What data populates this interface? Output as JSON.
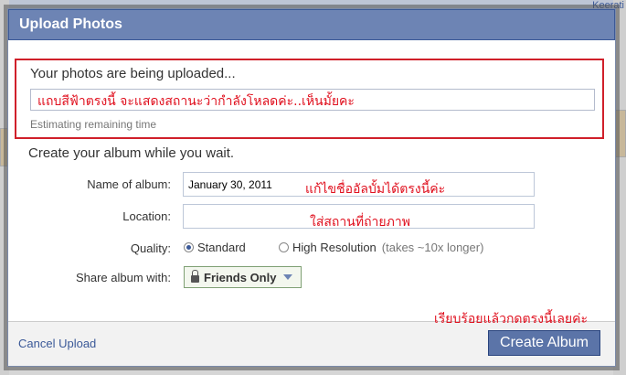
{
  "background": {
    "user_name": "Keerati"
  },
  "dialog": {
    "title": "Upload Photos",
    "upload_status": "Your photos are being uploaded...",
    "progress_fraction": 0.0,
    "progress_note": "แถบสีฟ้าตรงนี้ จะแสดงสถานะว่ากำลังโหลดค่ะ..เห็นมั้ยคะ",
    "estimating": "Estimating remaining time",
    "create_heading": "Create your album while you wait.",
    "fields": {
      "album_name": {
        "label": "Name of album:",
        "value": "January 30, 2011",
        "note": "แก้ไขชื่ออัลบั้มได้ตรงนี้ค่ะ"
      },
      "location": {
        "label": "Location:",
        "value": "",
        "note": "ใส่สถานที่ถ่ายภาพ"
      },
      "quality": {
        "label": "Quality:",
        "options": [
          {
            "label": "Standard",
            "selected": true
          },
          {
            "label": "High Resolution",
            "selected": false
          }
        ],
        "hint": "(takes ~10x longer)"
      },
      "share": {
        "label": "Share album with:",
        "value": "Friends Only"
      }
    },
    "footer": {
      "cancel": "Cancel Upload",
      "create": "Create Album",
      "note": "เรียบร้อยแล้วกดตรงนี้เลยค่ะ"
    }
  },
  "colors": {
    "accent": "#6d84b4",
    "annotation": "#e0101e",
    "highlight_border": "#d0202a"
  }
}
